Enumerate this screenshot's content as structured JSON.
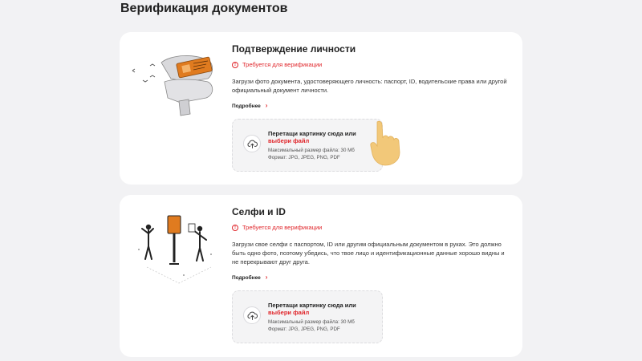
{
  "page": {
    "title": "Верификация документов"
  },
  "cards": {
    "identity": {
      "title": "Подтверждение личности",
      "status": "Требуется для верификации",
      "description": "Загрузи фото документа, удостоверяющего личность: паспорт, ID, водительские права или другой официальный документ личности.",
      "more_label": "Подробнее",
      "dropzone": {
        "line1": "Перетащи картинку сюда или",
        "link": "выбери файл",
        "max_size": "Максимальный размер файла: 30 Мб",
        "formats": "Формат: JPG, JPEG, PNG, PDF"
      }
    },
    "selfie": {
      "title": "Селфи и ID",
      "status": "Требуется для верификации",
      "description": "Загрузи свое селфи с паспортом, ID или другим официальным документом в руках. Это должно быть одно фото, поэтому убедись, что твое лицо и идентификационные данные хорошо видны и не перекрывают друг друга.",
      "more_label": "Подробнее",
      "dropzone": {
        "line1": "Перетащи картинку сюда или",
        "link": "выбери файл",
        "max_size": "Максимальный размер файла: 30 Мб",
        "formats": "Формат: JPG, JPEG, PNG, PDF"
      }
    }
  },
  "icons": {
    "warning": "warning-circle-icon",
    "chevron": "chevron-right-icon",
    "upload": "cloud-upload-icon",
    "hand": "pointing-hand-icon"
  },
  "colors": {
    "accent": "#e0262b",
    "background": "#f2f2f4",
    "card": "#ffffff",
    "dropzone": "#f4f4f5",
    "hand": "#f2c879",
    "document": "#e07b1f"
  }
}
